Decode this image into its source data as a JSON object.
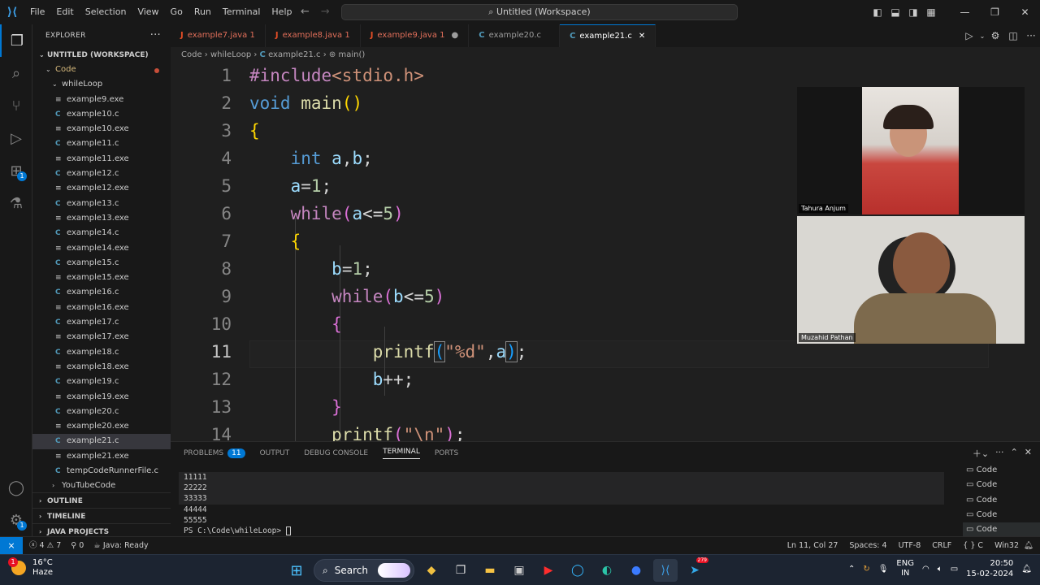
{
  "titlebar": {
    "menu": [
      "File",
      "Edit",
      "Selection",
      "View",
      "Go",
      "Run",
      "Terminal",
      "Help"
    ],
    "command_center": "Untitled (Workspace)"
  },
  "activity": {
    "extensions_badge": "1",
    "manage_badge": "1"
  },
  "explorer": {
    "title": "EXPLORER",
    "workspace": "UNTITLED (WORKSPACE)",
    "root_folder": "Code",
    "subfolder": "whileLoop",
    "files": [
      {
        "name": "example9.exe",
        "type": "exe"
      },
      {
        "name": "example10.c",
        "type": "c"
      },
      {
        "name": "example10.exe",
        "type": "exe"
      },
      {
        "name": "example11.c",
        "type": "c"
      },
      {
        "name": "example11.exe",
        "type": "exe"
      },
      {
        "name": "example12.c",
        "type": "c"
      },
      {
        "name": "example12.exe",
        "type": "exe"
      },
      {
        "name": "example13.c",
        "type": "c"
      },
      {
        "name": "example13.exe",
        "type": "exe"
      },
      {
        "name": "example14.c",
        "type": "c"
      },
      {
        "name": "example14.exe",
        "type": "exe"
      },
      {
        "name": "example15.c",
        "type": "c"
      },
      {
        "name": "example15.exe",
        "type": "exe"
      },
      {
        "name": "example16.c",
        "type": "c"
      },
      {
        "name": "example16.exe",
        "type": "exe"
      },
      {
        "name": "example17.c",
        "type": "c"
      },
      {
        "name": "example17.exe",
        "type": "exe"
      },
      {
        "name": "example18.c",
        "type": "c"
      },
      {
        "name": "example18.exe",
        "type": "exe"
      },
      {
        "name": "example19.c",
        "type": "c"
      },
      {
        "name": "example19.exe",
        "type": "exe"
      },
      {
        "name": "example20.c",
        "type": "c"
      },
      {
        "name": "example20.exe",
        "type": "exe"
      },
      {
        "name": "example21.c",
        "type": "c",
        "selected": true
      },
      {
        "name": "example21.exe",
        "type": "exe"
      },
      {
        "name": "tempCodeRunnerFile.c",
        "type": "c"
      }
    ],
    "other_folder": "YouTubeCode",
    "sections": [
      "OUTLINE",
      "TIMELINE",
      "JAVA PROJECTS"
    ]
  },
  "tabs": [
    {
      "name": "example7.java",
      "type": "java",
      "errors": "1"
    },
    {
      "name": "example8.java",
      "type": "java",
      "errors": "1"
    },
    {
      "name": "example9.java",
      "type": "java",
      "errors": "1",
      "modified": true
    },
    {
      "name": "example20.c",
      "type": "c"
    },
    {
      "name": "example21.c",
      "type": "c",
      "active": true
    }
  ],
  "breadcrumb": [
    "Code",
    "whileLoop",
    "example21.c",
    "main()"
  ],
  "code": {
    "line_numbers": [
      "1",
      "2",
      "3",
      "4",
      "5",
      "6",
      "7",
      "8",
      "9",
      "10",
      "11",
      "12",
      "13",
      "14"
    ],
    "current_line": "11"
  },
  "panel": {
    "tabs": [
      "PROBLEMS",
      "OUTPUT",
      "DEBUG CONSOLE",
      "TERMINAL",
      "PORTS"
    ],
    "problems_count": "11",
    "active_tab": "TERMINAL",
    "terminal_lines": [
      "11111",
      "22222",
      "33333",
      "44444",
      "55555"
    ],
    "prompt": "PS C:\\Code\\whileLoop> ",
    "terminal_list": [
      "Code",
      "Code",
      "Code",
      "Code",
      "Code"
    ]
  },
  "statusbar": {
    "errors": "4",
    "warnings": "7",
    "ports": "0",
    "java": "Java: Ready",
    "position": "Ln 11, Col 27",
    "spaces": "Spaces: 4",
    "encoding": "UTF-8",
    "eol": "CRLF",
    "language": "C",
    "platform": "Win32"
  },
  "video": {
    "participant1": "Tahura Anjum",
    "participant2": "Muzahid Pathan"
  },
  "taskbar": {
    "weather_temp": "16°C",
    "weather_desc": "Haze",
    "weather_badge": "1",
    "search_label": "Search",
    "lang_top": "ENG",
    "lang_bottom": "IN",
    "time": "20:50",
    "date": "15-02-2024",
    "telegram_badge": "279"
  }
}
